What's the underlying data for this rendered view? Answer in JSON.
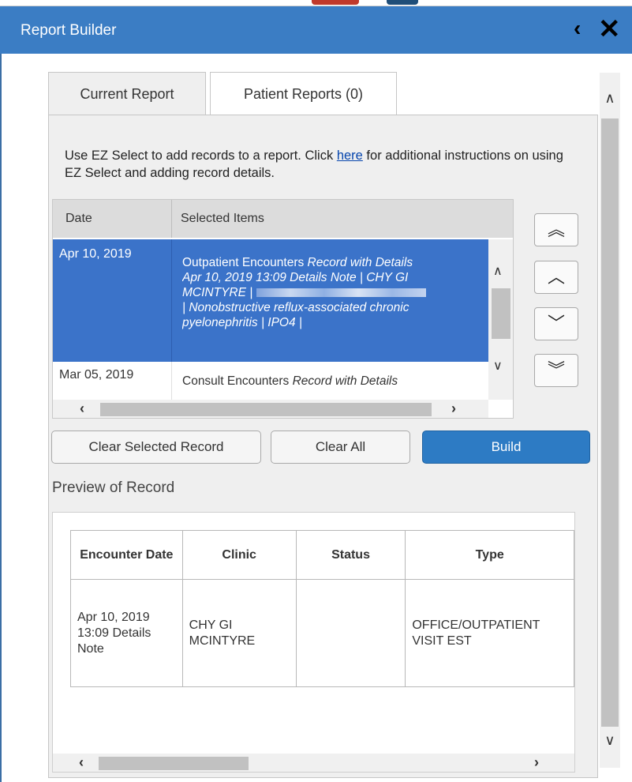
{
  "window": {
    "title": "Report Builder",
    "collapse_icon": "chevron-left-icon",
    "close_icon": "close-icon"
  },
  "tabs": [
    {
      "label": "Current Report",
      "active": true
    },
    {
      "label": "Patient Reports (0)",
      "active": false
    }
  ],
  "instructions": {
    "before": "Use EZ Select to add records to a report. Click ",
    "link": "here",
    "after": " for additional instructions on using EZ Select and adding record details."
  },
  "records_table": {
    "headers": [
      "Date",
      "Selected Items"
    ],
    "rows": [
      {
        "date": "Apr 10, 2019",
        "selected": true,
        "line1_plain": "Outpatient Encounters ",
        "line1_italic": "Record with Details",
        "line2": "Apr 10, 2019 13:09 Details Note  |  CHY GI",
        "line3": "MCINTYRE  |",
        "line4": "  |  Nonobstructive reflux-associated chronic",
        "line5": "pyelonephritis  |  IPO4  |"
      },
      {
        "date": "Mar 05, 2019",
        "selected": false,
        "line1_plain": "Consult Encounters ",
        "line1_italic": "Record with Details"
      }
    ]
  },
  "move_buttons": [
    {
      "name": "move-to-top",
      "glyph": "︽"
    },
    {
      "name": "move-up",
      "glyph": "︿"
    },
    {
      "name": "move-down",
      "glyph": "﹀"
    },
    {
      "name": "move-to-bottom",
      "glyph": "︾"
    }
  ],
  "actions": {
    "clear_selected": "Clear Selected Record",
    "clear_all": "Clear All",
    "build": "Build"
  },
  "preview": {
    "label": "Preview of Record",
    "headers": [
      "Encounter Date",
      "Clinic",
      "Status",
      "Type"
    ],
    "row": {
      "date": "Apr 10, 2019 13:09 Details Note",
      "clinic": "CHY GI MCINTYRE",
      "status": "",
      "type": "OFFICE/OUTPATIENT VISIT EST"
    }
  },
  "colors": {
    "titlebar": "#3b7dc4",
    "selected_row": "#3b73c9",
    "build_button": "#2d7bc4"
  }
}
